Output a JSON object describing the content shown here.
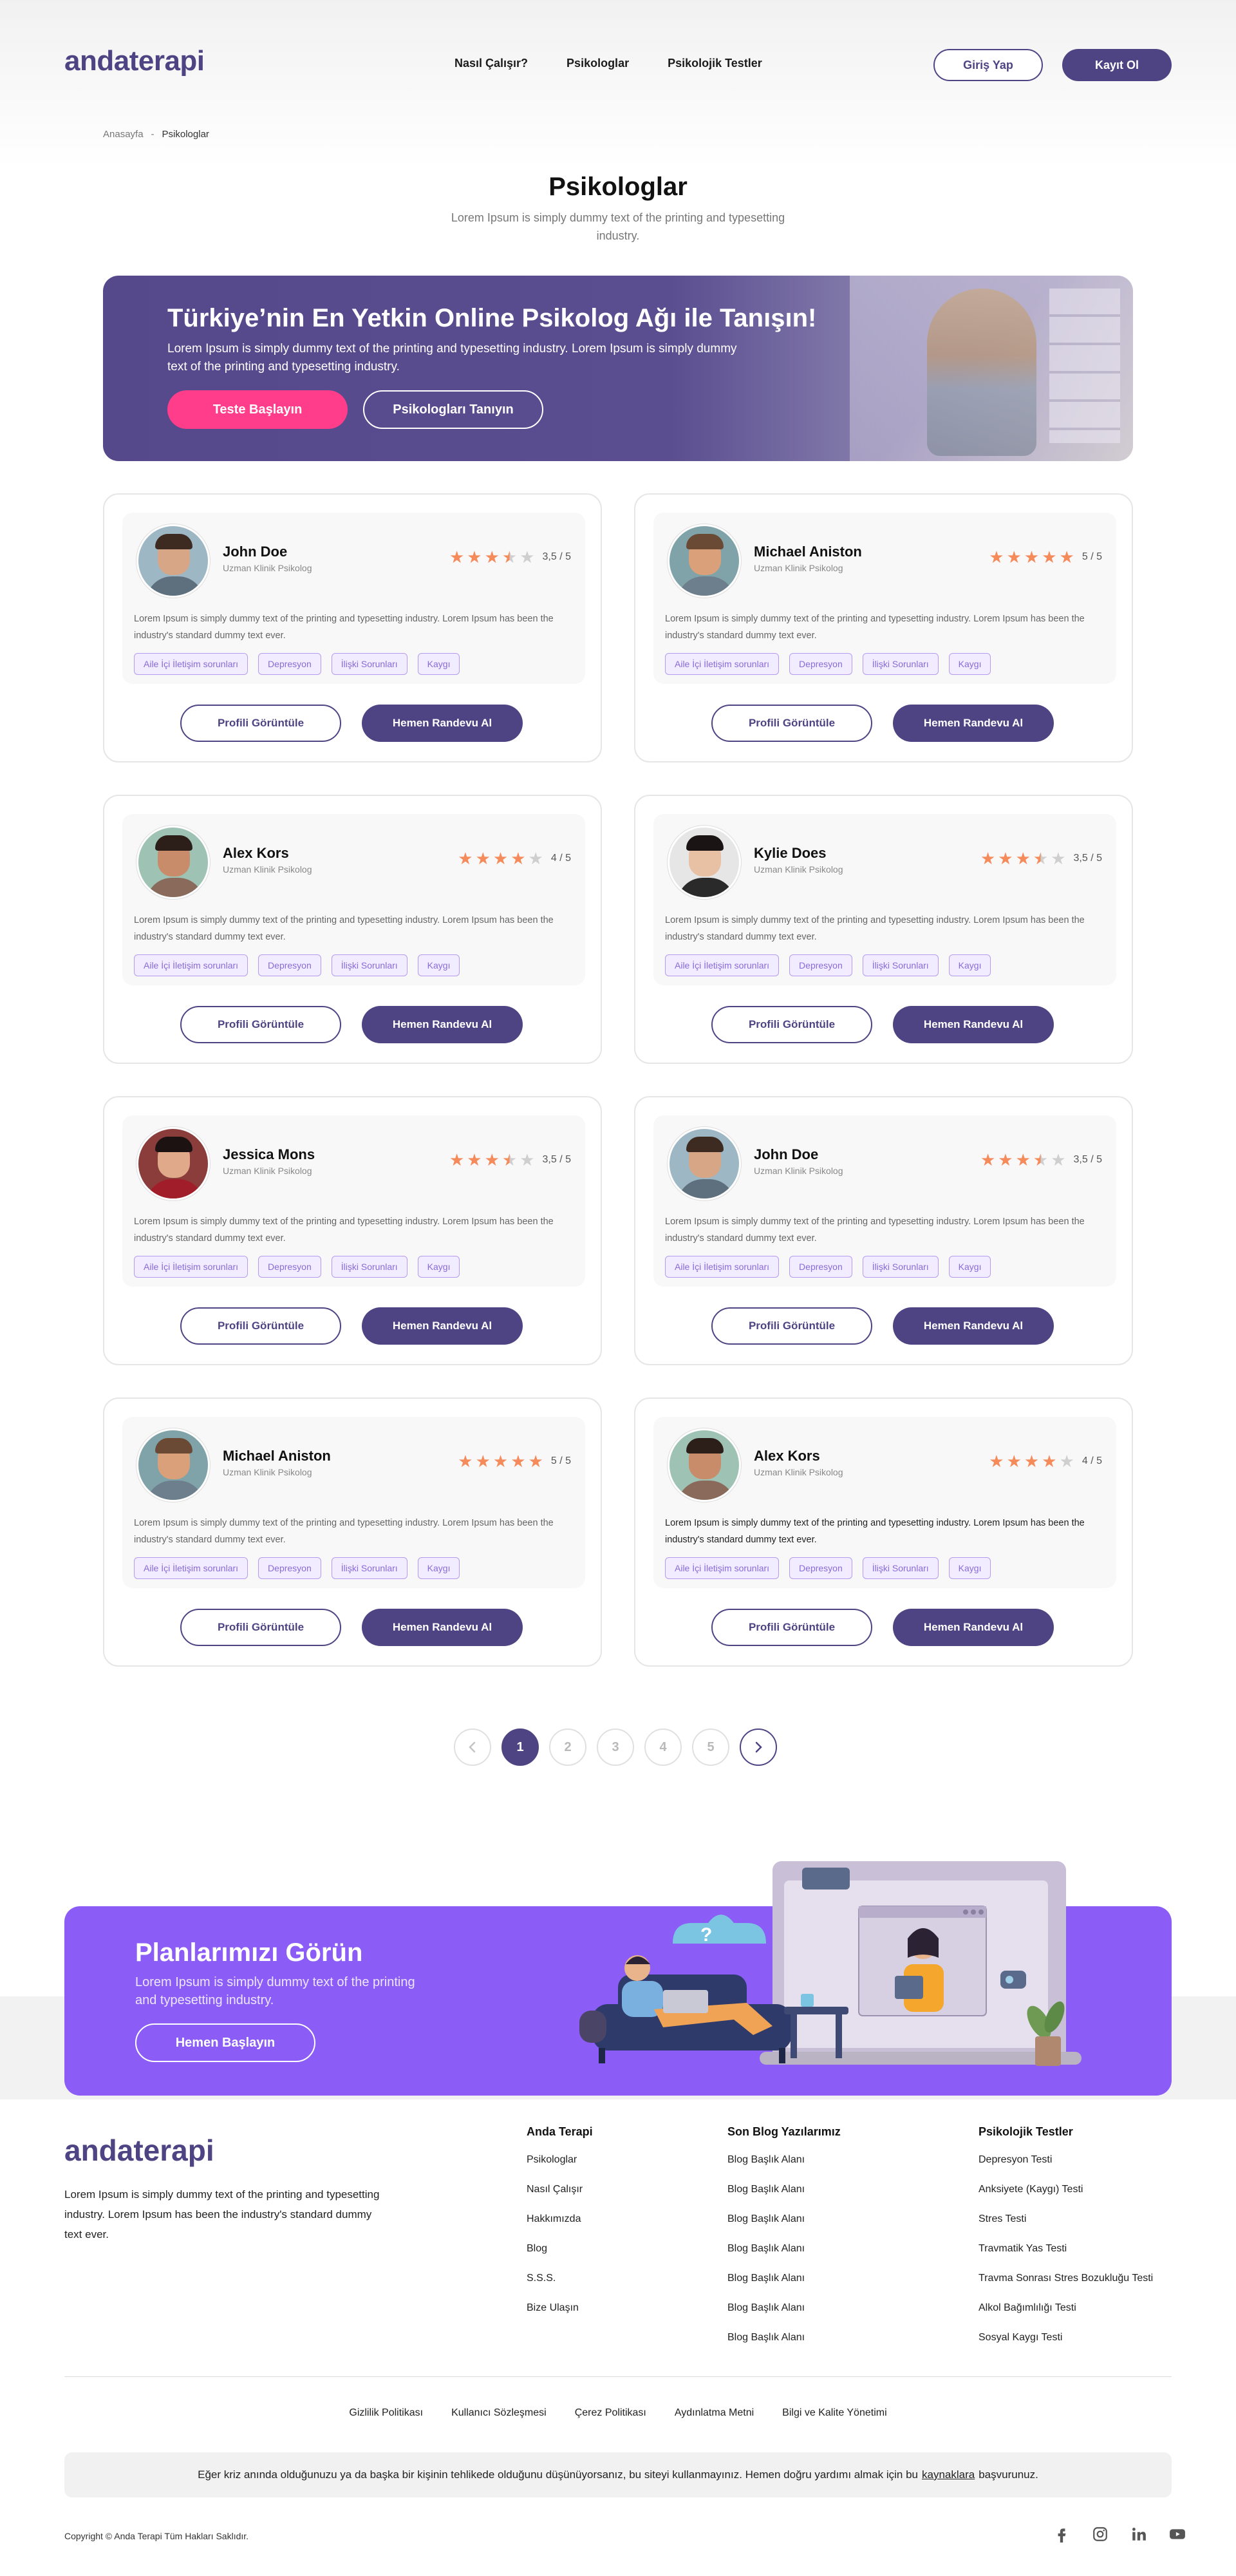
{
  "header": {
    "logo": "andaterapi",
    "nav": [
      "Nasıl Çalışır?",
      "Psikologlar",
      "Psikolojik Testler"
    ],
    "login": "Giriş Yap",
    "register": "Kayıt Ol"
  },
  "breadcrumb": {
    "home": "Anasayfa",
    "separator": "-",
    "current": "Psikologlar"
  },
  "page": {
    "title": "Psikologlar",
    "subtitle": "Lorem Ipsum is simply dummy text of the printing and typesetting industry."
  },
  "hero": {
    "title": "Türkiye’nin En Yetkin Online Psikolog Ağı ile Tanışın!",
    "text": "Lorem Ipsum is simply dummy text of the printing and typesetting industry. Lorem Ipsum is simply dummy text of the printing and typesetting industry.",
    "primary_button": "Teste Başlayın",
    "secondary_button": "Psikologları Tanıyın"
  },
  "cards": [
    {
      "name": "John Doe",
      "role": "Uzman Klinik Psikolog",
      "rating": 3.5,
      "score": "3,5 / 5",
      "desc": "Lorem Ipsum is simply dummy text of the printing and typesetting industry. Lorem Ipsum has been the industry's standard dummy text ever.",
      "tags": [
        "Aile İçi İletişim sorunları",
        "Depresyon",
        "İlişki Sorunları",
        "Kaygı"
      ],
      "profile_button": "Profili Görüntüle",
      "appointment_button": "Hemen Randevu Al"
    },
    {
      "name": "Michael Aniston",
      "role": "Uzman Klinik Psikolog",
      "rating": 5,
      "score": "5 / 5",
      "desc": "Lorem Ipsum is simply dummy text of the printing and typesetting industry. Lorem Ipsum has been the industry's standard dummy text ever.",
      "tags": [
        "Aile İçi İletişim sorunları",
        "Depresyon",
        "İlişki Sorunları",
        "Kaygı"
      ],
      "profile_button": "Profili Görüntüle",
      "appointment_button": "Hemen Randevu Al"
    },
    {
      "name": "Alex Kors",
      "role": "Uzman Klinik Psikolog",
      "rating": 4,
      "score": "4 / 5",
      "desc": "Lorem Ipsum is simply dummy text of the printing and typesetting industry. Lorem Ipsum has been the industry's standard dummy text ever.",
      "tags": [
        "Aile İçi İletişim sorunları",
        "Depresyon",
        "İlişki Sorunları",
        "Kaygı"
      ],
      "profile_button": "Profili Görüntüle",
      "appointment_button": "Hemen Randevu Al"
    },
    {
      "name": "Kylie Does",
      "role": "Uzman Klinik Psikolog",
      "rating": 3.5,
      "score": "3,5 / 5",
      "desc": "Lorem Ipsum is simply dummy text of the printing and typesetting industry. Lorem Ipsum has been the industry's standard dummy text ever.",
      "tags": [
        "Aile İçi İletişim sorunları",
        "Depresyon",
        "İlişki Sorunları",
        "Kaygı"
      ],
      "profile_button": "Profili Görüntüle",
      "appointment_button": "Hemen Randevu Al"
    },
    {
      "name": "Jessica Mons",
      "role": "Uzman Klinik Psikolog",
      "rating": 3.5,
      "score": "3,5 / 5",
      "desc": "Lorem Ipsum is simply dummy text of the printing and typesetting industry. Lorem Ipsum has been the industry's standard dummy text ever.",
      "tags": [
        "Aile İçi İletişim sorunları",
        "Depresyon",
        "İlişki Sorunları",
        "Kaygı"
      ],
      "profile_button": "Profili Görüntüle",
      "appointment_button": "Hemen Randevu Al"
    },
    {
      "name": "John Doe",
      "role": "Uzman Klinik Psikolog",
      "rating": 3.5,
      "score": "3,5 / 5",
      "desc": "Lorem Ipsum is simply dummy text of the printing and typesetting industry. Lorem Ipsum has been the industry's standard dummy text ever.",
      "tags": [
        "Aile İçi İletişim sorunları",
        "Depresyon",
        "İlişki Sorunları",
        "Kaygı"
      ],
      "profile_button": "Profili Görüntüle",
      "appointment_button": "Hemen Randevu Al"
    },
    {
      "name": "Michael Aniston",
      "role": "Uzman Klinik Psikolog",
      "rating": 5,
      "score": "5 / 5",
      "desc": "Lorem Ipsum is simply dummy text of the printing and typesetting industry. Lorem Ipsum has been the industry's standard dummy text ever.",
      "tags": [
        "Aile İçi İletişim sorunları",
        "Depresyon",
        "İlişki Sorunları",
        "Kaygı"
      ],
      "profile_button": "Profili Görüntüle",
      "appointment_button": "Hemen Randevu Al"
    },
    {
      "name": "Alex Kors",
      "role": "Uzman Klinik Psikolog",
      "rating": 4,
      "score": "4 / 5",
      "desc": "Lorem Ipsum is simply dummy text of the printing and typesetting industry. Lorem Ipsum has been the industry's standard dummy text ever.",
      "tags": [
        "Aile İçi İletişim sorunları",
        "Depresyon",
        "İlişki Sorunları",
        "Kaygı"
      ],
      "profile_button": "Profili Görüntüle",
      "appointment_button": "Hemen Randevu Al"
    }
  ],
  "pagination": {
    "pages": [
      "1",
      "2",
      "3",
      "4",
      "5"
    ],
    "active": "1"
  },
  "cta": {
    "title": "Planlarımızı Görün",
    "text": "Lorem Ipsum is simply dummy text of the printing and typesetting industry.",
    "button": "Hemen Başlayın",
    "bubble": "?"
  },
  "footer": {
    "logo": "andaterapi",
    "about": "Lorem Ipsum is simply dummy text of the printing and typesetting industry. Lorem Ipsum has been the industry's standard dummy text ever.",
    "columns": [
      {
        "title": "Anda Terapi",
        "links": [
          "Psikologlar",
          "Nasıl Çalışır",
          "Hakkımızda",
          "Blog",
          "S.S.S.",
          "Bize Ulaşın"
        ]
      },
      {
        "title": "Son Blog Yazılarımız",
        "links": [
          "Blog Başlık Alanı",
          "Blog Başlık Alanı",
          "Blog Başlık Alanı",
          "Blog Başlık Alanı",
          "Blog Başlık Alanı",
          "Blog Başlık Alanı",
          "Blog Başlık Alanı"
        ]
      },
      {
        "title": "Psikolojik Testler",
        "links": [
          "Depresyon Testi",
          "Anksiyete (Kaygı) Testi",
          "Stres Testi",
          "Travmatik Yas Testi",
          "Travma Sonrası Stres Bozukluğu Testi",
          "Alkol Bağımlılığı Testi",
          "Sosyal Kaygı Testi"
        ]
      }
    ],
    "legal": [
      "Gizlilik Politikası",
      "Kullanıcı Sözleşmesi",
      "Çerez Politikası",
      "Aydınlatma Metni",
      "Bilgi ve Kalite Yönetimi"
    ],
    "notice_text": "Eğer kriz anında olduğunuzu ya da başka bir kişinin tehlikede olduğunu düşünüyorsanız, bu siteyi kullanmayınız. Hemen doğru yardımı almak için bu",
    "notice_link": "kaynaklara",
    "notice_end": "başvurunuz.",
    "copyright": "Copyright © Anda Terapi Tüm Hakları Saklıdır.",
    "socials": [
      "facebook-icon",
      "instagram-icon",
      "linkedin-icon",
      "youtube-icon"
    ]
  },
  "colors": {
    "brand": "#4e4484",
    "accent_pink": "#ff3d8b",
    "star": "#f58a5a",
    "cta_purple": "#8b5cf6"
  }
}
